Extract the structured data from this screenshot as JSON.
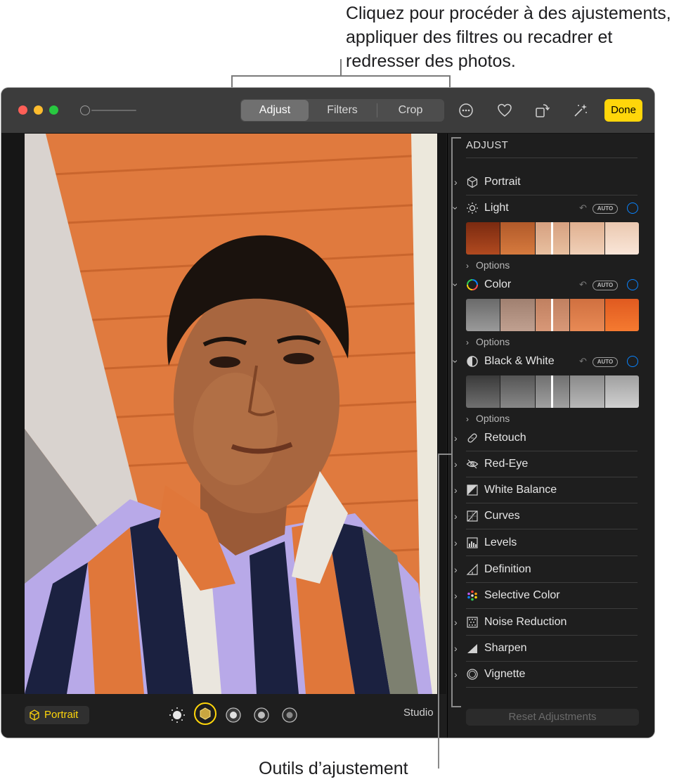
{
  "callouts": {
    "top": "Cliquez pour procéder à des ajustements, appliquer des filtres ou recadrer et redresser des photos.",
    "bottom": "Outils d’ajustement"
  },
  "toolbar": {
    "tabs": [
      "Adjust",
      "Filters",
      "Crop"
    ],
    "active_tab": "Adjust",
    "done_label": "Done",
    "icons": [
      "more-icon",
      "heart-icon",
      "rotate-icon",
      "magic-wand-icon"
    ]
  },
  "bottombar": {
    "portrait_label": "Portrait",
    "lighting_label": "Studio",
    "lighting_icons": [
      "natural-light-icon",
      "studio-light-icon",
      "contour-light-icon",
      "stage-light-icon",
      "stage-mono-icon"
    ]
  },
  "sidebar": {
    "header": "ADJUST",
    "items": [
      {
        "label": "Portrait",
        "icon": "cube-icon",
        "expanded": false
      },
      {
        "label": "Light",
        "icon": "sun-icon",
        "expanded": true,
        "auto": "AUTO",
        "options": "Options"
      },
      {
        "label": "Color",
        "icon": "color-wheel-icon",
        "expanded": true,
        "auto": "AUTO",
        "options": "Options"
      },
      {
        "label": "Black & White",
        "icon": "half-circle-icon",
        "expanded": true,
        "auto": "AUTO",
        "options": "Options"
      },
      {
        "label": "Retouch",
        "icon": "bandage-icon",
        "expanded": false
      },
      {
        "label": "Red-Eye",
        "icon": "eye-icon",
        "expanded": false
      },
      {
        "label": "White Balance",
        "icon": "white-balance-icon",
        "expanded": false
      },
      {
        "label": "Curves",
        "icon": "curves-icon",
        "expanded": false
      },
      {
        "label": "Levels",
        "icon": "levels-icon",
        "expanded": false
      },
      {
        "label": "Definition",
        "icon": "triangle-icon",
        "expanded": false
      },
      {
        "label": "Selective Color",
        "icon": "dots-icon",
        "expanded": false
      },
      {
        "label": "Noise Reduction",
        "icon": "noise-icon",
        "expanded": false
      },
      {
        "label": "Sharpen",
        "icon": "sharpen-icon",
        "expanded": false
      },
      {
        "label": "Vignette",
        "icon": "vignette-icon",
        "expanded": false
      }
    ],
    "reset_label": "Reset Adjustments"
  },
  "colors": {
    "accent_yellow": "#ffd60a",
    "accent_blue": "#0a84ff",
    "sidebar_bg": "#1e1e1e",
    "titlebar_bg": "#3c3c3c"
  }
}
